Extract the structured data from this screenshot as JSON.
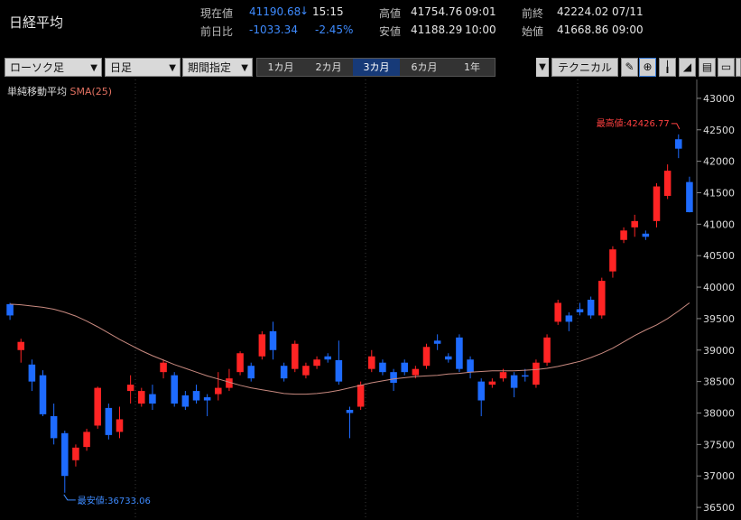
{
  "header": {
    "title": "日経平均",
    "current_label": "現在値",
    "current_value": "41190.68",
    "current_arrow": "↓",
    "current_time": "15:15",
    "change_label": "前日比",
    "change_value": "-1033.34",
    "change_pct": "-2.45%",
    "high_label": "高値",
    "high_value": "41754.76",
    "high_time": "09:01",
    "low_label": "安値",
    "low_value": "41188.29",
    "low_time": "10:00",
    "prev_label": "前終",
    "prev_value": "42224.02",
    "prev_date": "07/11",
    "open_label": "始値",
    "open_value": "41668.86",
    "open_time": "09:00"
  },
  "toolbar": {
    "chart_type": "ローソク足",
    "interval": "日足",
    "period_select": "期間指定",
    "periods": [
      "1カ月",
      "2カ月",
      "3カ月",
      "6カ月",
      "1年"
    ],
    "active_period": "3カ月",
    "technical": "テクニカル",
    "icons": [
      "pen-icon",
      "zoom-icon",
      "bar-chart-icon",
      "area-chart-icon",
      "save-icon",
      "folder-icon",
      "print-icon"
    ]
  },
  "colors": {
    "up": "#ff2424",
    "down": "#1e6bff",
    "sma": "#c98a80",
    "grid": "#2a2a2a"
  },
  "chart_data": {
    "type": "candlestick",
    "indicator_label": "単純移動平均",
    "indicator_param": "SMA(25)",
    "ylim": [
      36300,
      43300
    ],
    "yticks": [
      36500,
      37000,
      37500,
      38000,
      38500,
      39000,
      39500,
      40000,
      40500,
      41000,
      41500,
      42000,
      42500,
      43000
    ],
    "max_label": "最高値:42426.77",
    "min_label": "最安値:36733.06",
    "candles": [
      {
        "o": 39730,
        "c": 39550,
        "h": 39750,
        "l": 39480
      },
      {
        "o": 39000,
        "c": 39130,
        "h": 39180,
        "l": 38800
      },
      {
        "o": 38770,
        "c": 38500,
        "h": 38850,
        "l": 38350
      },
      {
        "o": 38600,
        "c": 37980,
        "h": 38680,
        "l": 37950
      },
      {
        "o": 37950,
        "c": 37600,
        "h": 38150,
        "l": 37500
      },
      {
        "o": 37680,
        "c": 37000,
        "h": 37720,
        "l": 36733
      },
      {
        "o": 37250,
        "c": 37450,
        "h": 37500,
        "l": 37150
      },
      {
        "o": 37460,
        "c": 37700,
        "h": 37750,
        "l": 37400
      },
      {
        "o": 37800,
        "c": 38400,
        "h": 38420,
        "l": 37750
      },
      {
        "o": 38080,
        "c": 37650,
        "h": 38150,
        "l": 37580
      },
      {
        "o": 37700,
        "c": 37900,
        "h": 38100,
        "l": 37600
      },
      {
        "o": 38350,
        "c": 38450,
        "h": 38600,
        "l": 38150
      },
      {
        "o": 38150,
        "c": 38350,
        "h": 38400,
        "l": 38100
      },
      {
        "o": 38300,
        "c": 38150,
        "h": 38450,
        "l": 38050
      },
      {
        "o": 38650,
        "c": 38800,
        "h": 38850,
        "l": 38550
      },
      {
        "o": 38600,
        "c": 38150,
        "h": 38650,
        "l": 38100
      },
      {
        "o": 38280,
        "c": 38100,
        "h": 38350,
        "l": 38050
      },
      {
        "o": 38350,
        "c": 38200,
        "h": 38450,
        "l": 38150
      },
      {
        "o": 38250,
        "c": 38200,
        "h": 38300,
        "l": 37950
      },
      {
        "o": 38300,
        "c": 38400,
        "h": 38650,
        "l": 38200
      },
      {
        "o": 38400,
        "c": 38550,
        "h": 38700,
        "l": 38350
      },
      {
        "o": 38650,
        "c": 38950,
        "h": 38980,
        "l": 38600
      },
      {
        "o": 38750,
        "c": 38550,
        "h": 38800,
        "l": 38500
      },
      {
        "o": 38900,
        "c": 39250,
        "h": 39300,
        "l": 38850
      },
      {
        "o": 39300,
        "c": 39000,
        "h": 39450,
        "l": 38850
      },
      {
        "o": 38750,
        "c": 38550,
        "h": 38800,
        "l": 38500
      },
      {
        "o": 38700,
        "c": 39100,
        "h": 39150,
        "l": 38650
      },
      {
        "o": 38600,
        "c": 38750,
        "h": 38800,
        "l": 38550
      },
      {
        "o": 38750,
        "c": 38850,
        "h": 38900,
        "l": 38700
      },
      {
        "o": 38900,
        "c": 38850,
        "h": 38950,
        "l": 38800
      },
      {
        "o": 38840,
        "c": 38500,
        "h": 39150,
        "l": 38450
      },
      {
        "o": 38050,
        "c": 38000,
        "h": 38100,
        "l": 37600
      },
      {
        "o": 38100,
        "c": 38450,
        "h": 38500,
        "l": 38050
      },
      {
        "o": 38700,
        "c": 38900,
        "h": 39000,
        "l": 38650
      },
      {
        "o": 38800,
        "c": 38650,
        "h": 38850,
        "l": 38600
      },
      {
        "o": 38650,
        "c": 38480,
        "h": 38700,
        "l": 38350
      },
      {
        "o": 38800,
        "c": 38650,
        "h": 38850,
        "l": 38600
      },
      {
        "o": 38600,
        "c": 38700,
        "h": 38750,
        "l": 38550
      },
      {
        "o": 38750,
        "c": 39050,
        "h": 39100,
        "l": 38700
      },
      {
        "o": 39150,
        "c": 39100,
        "h": 39250,
        "l": 39000
      },
      {
        "o": 38900,
        "c": 38850,
        "h": 38950,
        "l": 38800
      },
      {
        "o": 39200,
        "c": 38700,
        "h": 39250,
        "l": 38650
      },
      {
        "o": 38850,
        "c": 38650,
        "h": 38900,
        "l": 38550
      },
      {
        "o": 38500,
        "c": 38200,
        "h": 38550,
        "l": 37950
      },
      {
        "o": 38450,
        "c": 38500,
        "h": 38550,
        "l": 38400
      },
      {
        "o": 38550,
        "c": 38650,
        "h": 38700,
        "l": 38500
      },
      {
        "o": 38600,
        "c": 38400,
        "h": 38650,
        "l": 38250
      },
      {
        "o": 38600,
        "c": 38600,
        "h": 38700,
        "l": 38500
      },
      {
        "o": 38450,
        "c": 38800,
        "h": 38850,
        "l": 38400
      },
      {
        "o": 38800,
        "c": 39200,
        "h": 39250,
        "l": 38750
      },
      {
        "o": 39450,
        "c": 39750,
        "h": 39800,
        "l": 39400
      },
      {
        "o": 39550,
        "c": 39450,
        "h": 39600,
        "l": 39300
      },
      {
        "o": 39650,
        "c": 39600,
        "h": 39750,
        "l": 39550
      },
      {
        "o": 39800,
        "c": 39550,
        "h": 39850,
        "l": 39500
      },
      {
        "o": 39550,
        "c": 40100,
        "h": 40150,
        "l": 39500
      },
      {
        "o": 40250,
        "c": 40600,
        "h": 40650,
        "l": 40150
      },
      {
        "o": 40750,
        "c": 40900,
        "h": 40950,
        "l": 40700
      },
      {
        "o": 40950,
        "c": 41050,
        "h": 41150,
        "l": 40800
      },
      {
        "o": 40850,
        "c": 40800,
        "h": 40900,
        "l": 40750
      },
      {
        "o": 41050,
        "c": 41600,
        "h": 41650,
        "l": 40950
      },
      {
        "o": 41450,
        "c": 41850,
        "h": 41950,
        "l": 41400
      },
      {
        "o": 42350,
        "c": 42200,
        "h": 42427,
        "l": 42050
      },
      {
        "o": 41670,
        "c": 41191,
        "h": 41755,
        "l": 41188
      }
    ],
    "sma": [
      39730,
      39720,
      39700,
      39680,
      39650,
      39600,
      39540,
      39460,
      39370,
      39270,
      39170,
      39080,
      38990,
      38910,
      38840,
      38770,
      38710,
      38650,
      38590,
      38540,
      38490,
      38440,
      38400,
      38370,
      38340,
      38310,
      38300,
      38300,
      38310,
      38330,
      38360,
      38400,
      38440,
      38480,
      38510,
      38540,
      38560,
      38580,
      38590,
      38600,
      38620,
      38630,
      38650,
      38660,
      38670,
      38670,
      38670,
      38680,
      38690,
      38710,
      38740,
      38780,
      38820,
      38880,
      38950,
      39030,
      39130,
      39230,
      39320,
      39400,
      39500,
      39620,
      39750
    ]
  }
}
